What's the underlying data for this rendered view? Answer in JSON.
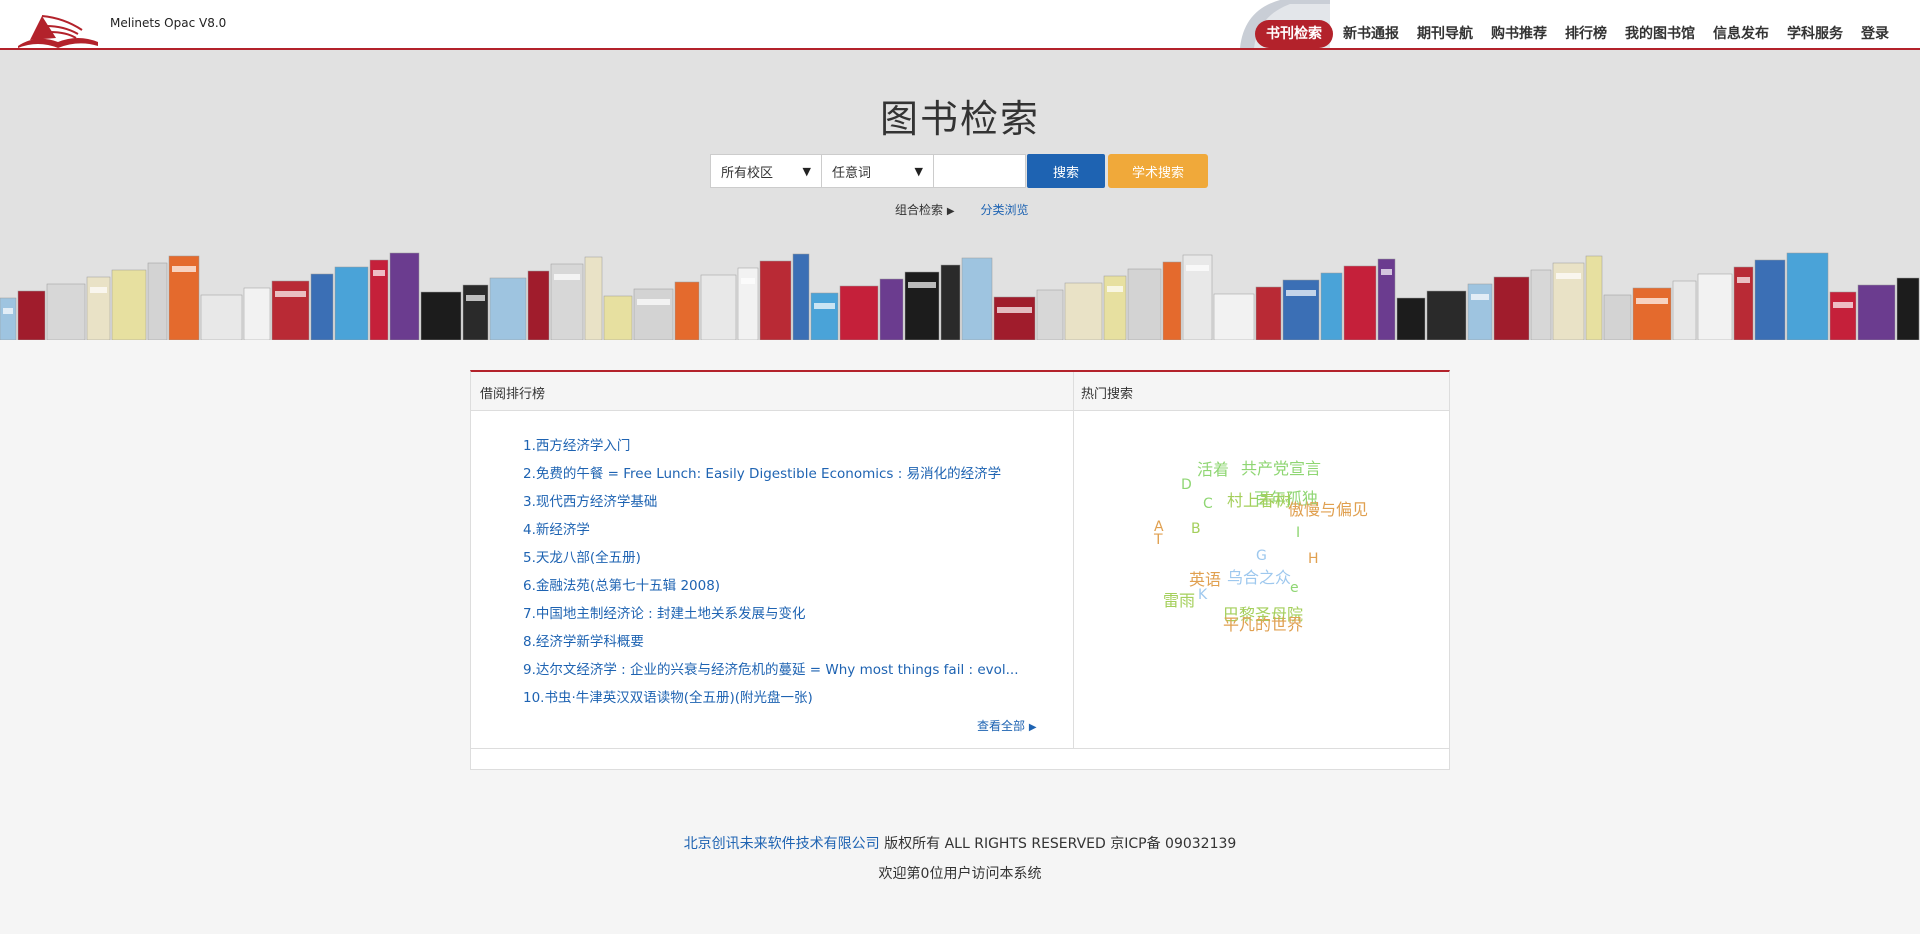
{
  "brand": "Melinets Opac V8.0",
  "nav": [
    "书刊检索",
    "新书通报",
    "期刊导航",
    "购书推荐",
    "排行榜",
    "我的图书馆",
    "信息发布",
    "学科服务",
    "登录"
  ],
  "search": {
    "title": "图书检索",
    "campus_value": "所有校区",
    "field_value": "任意词",
    "input_value": "",
    "search_label": "搜索",
    "academic_label": "学术搜索",
    "combo_label": "组合检索",
    "browse_label": "分类浏览"
  },
  "panel": {
    "ranking_title": "借阅排行榜",
    "hot_title": "热门搜索",
    "view_all": "查看全部",
    "ranking": [
      "1.西方经济学入门",
      "2.免费的午餐 = Free Lunch: Easily Digestible Economics : 易消化的经济学",
      "3.现代西方经济学基础",
      "4.新经济学",
      "5.天龙八部(全五册)",
      "6.金融法苑(总第七十五辑 2008)",
      "7.中国地主制经济论 : 封建土地关系发展与变化",
      "8.经济学新学科概要",
      "9.达尔文经济学 : 企业的兴衰与经济危机的蔓延 = Why most things fail : evol...",
      "10.书虫·牛津英汉双语读物(全五册)(附光盘一张)"
    ],
    "hot_words": [
      {
        "text": "活着",
        "color": "#8fd673"
      },
      {
        "text": "共产党宣言",
        "color": "#8fd673"
      },
      {
        "text": "D",
        "color": "#8fd673"
      },
      {
        "text": "百年孤独",
        "color": "#8fd673"
      },
      {
        "text": "村上春树",
        "color": "#a4cf5b"
      },
      {
        "text": "傲慢与偏见",
        "color": "#e0a050"
      },
      {
        "text": "C",
        "color": "#8fd673"
      },
      {
        "text": "A",
        "color": "#e0a050"
      },
      {
        "text": "B",
        "color": "#a4cf5b"
      },
      {
        "text": "T",
        "color": "#e0a050"
      },
      {
        "text": "I",
        "color": "#8fd673"
      },
      {
        "text": "G",
        "color": "#9ec8ee"
      },
      {
        "text": "H",
        "color": "#e0a050"
      },
      {
        "text": "英语",
        "color": "#e0a050"
      },
      {
        "text": "乌合之众",
        "color": "#9ec8ee"
      },
      {
        "text": "e",
        "color": "#8fd673"
      },
      {
        "text": "雷雨",
        "color": "#a4cf5b"
      },
      {
        "text": "K",
        "color": "#9ec8ee"
      },
      {
        "text": "巴黎圣母院",
        "color": "#a4cf5b"
      },
      {
        "text": "平凡的世界",
        "color": "#e0a050"
      }
    ]
  },
  "footer": {
    "company": "北京创讯未来软件技术有限公司",
    "rights": " 版权所有 ALL RIGHTS RESERVED 京ICP备 09032139",
    "visitors": "欢迎第0位用户访问本系统"
  }
}
